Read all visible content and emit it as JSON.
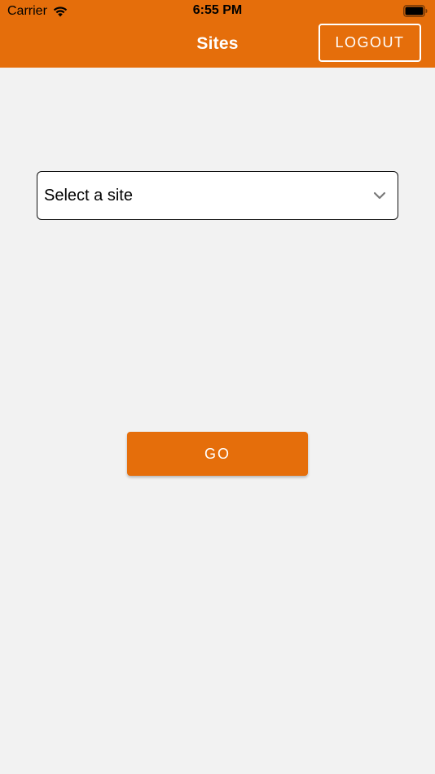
{
  "status_bar": {
    "carrier": "Carrier",
    "time": "6:55 PM",
    "wifi_icon": "wifi-icon",
    "battery_icon": "battery-icon"
  },
  "navbar": {
    "title": "Sites",
    "logout_label": "LOGOUT",
    "background_color": "#e56e0b"
  },
  "main": {
    "site_select": {
      "value": "Select a site",
      "icon": "chevron-down-icon"
    },
    "go_label": "GO"
  },
  "colors": {
    "accent": "#e56e0b",
    "background": "#f2f2f2"
  }
}
